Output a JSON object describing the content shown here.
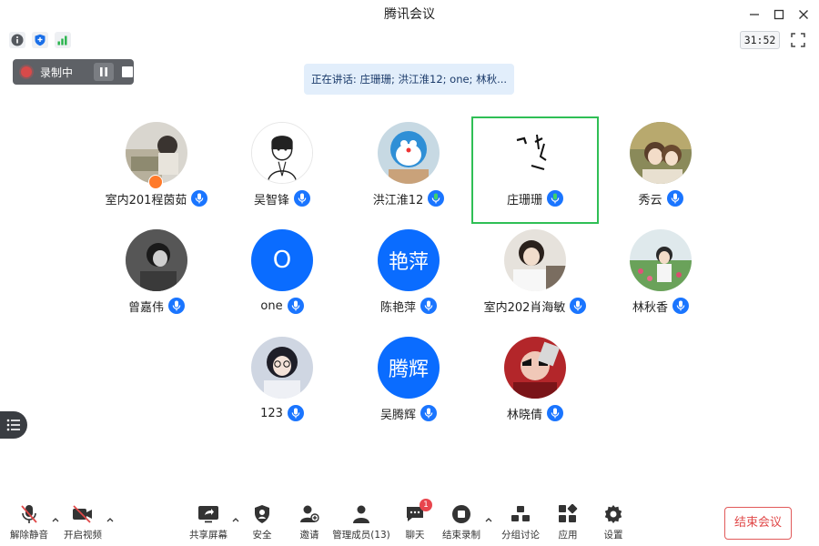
{
  "window": {
    "title": "腾讯会议"
  },
  "meeting": {
    "timer": "31:52",
    "recording_label": "录制中",
    "speaking_text": "正在讲话: 庄珊珊; 洪江淮12; one; 林秋..."
  },
  "participants": [
    {
      "name": "室内201程茵茹",
      "avatar": "photo",
      "host": true
    },
    {
      "name": "吴智锋",
      "avatar": "photo"
    },
    {
      "name": "洪江淮12",
      "avatar": "photo",
      "speaking": true
    },
    {
      "name": "庄珊珊",
      "avatar": "photo",
      "active": true
    },
    {
      "name": "秀云",
      "avatar": "photo"
    },
    {
      "name": "曾嘉伟",
      "avatar": "photo"
    },
    {
      "name": "one",
      "avatar_text": "O"
    },
    {
      "name": "陈艳萍",
      "avatar_text": "艳萍"
    },
    {
      "name": "室内202肖海敏",
      "avatar": "photo"
    },
    {
      "name": "林秋香",
      "avatar": "photo"
    },
    {
      "name": "123",
      "avatar": "photo"
    },
    {
      "name": "吴腾辉",
      "avatar_text": "腾辉"
    },
    {
      "name": "林晓倩",
      "avatar": "photo"
    }
  ],
  "toolbar": {
    "unmute": "解除静音",
    "start_video": "开启视频",
    "share_screen": "共享屏幕",
    "security": "安全",
    "invite": "邀请",
    "manage_members": "管理成员(13)",
    "chat": "聊天",
    "chat_badge": "1",
    "end_recording": "结束录制",
    "breakout": "分组讨论",
    "apps": "应用",
    "settings": "设置",
    "end_meeting": "结束会议"
  },
  "colors": {
    "accent": "#0a6cff",
    "active_border": "#2fbf55",
    "danger": "#e04848"
  }
}
